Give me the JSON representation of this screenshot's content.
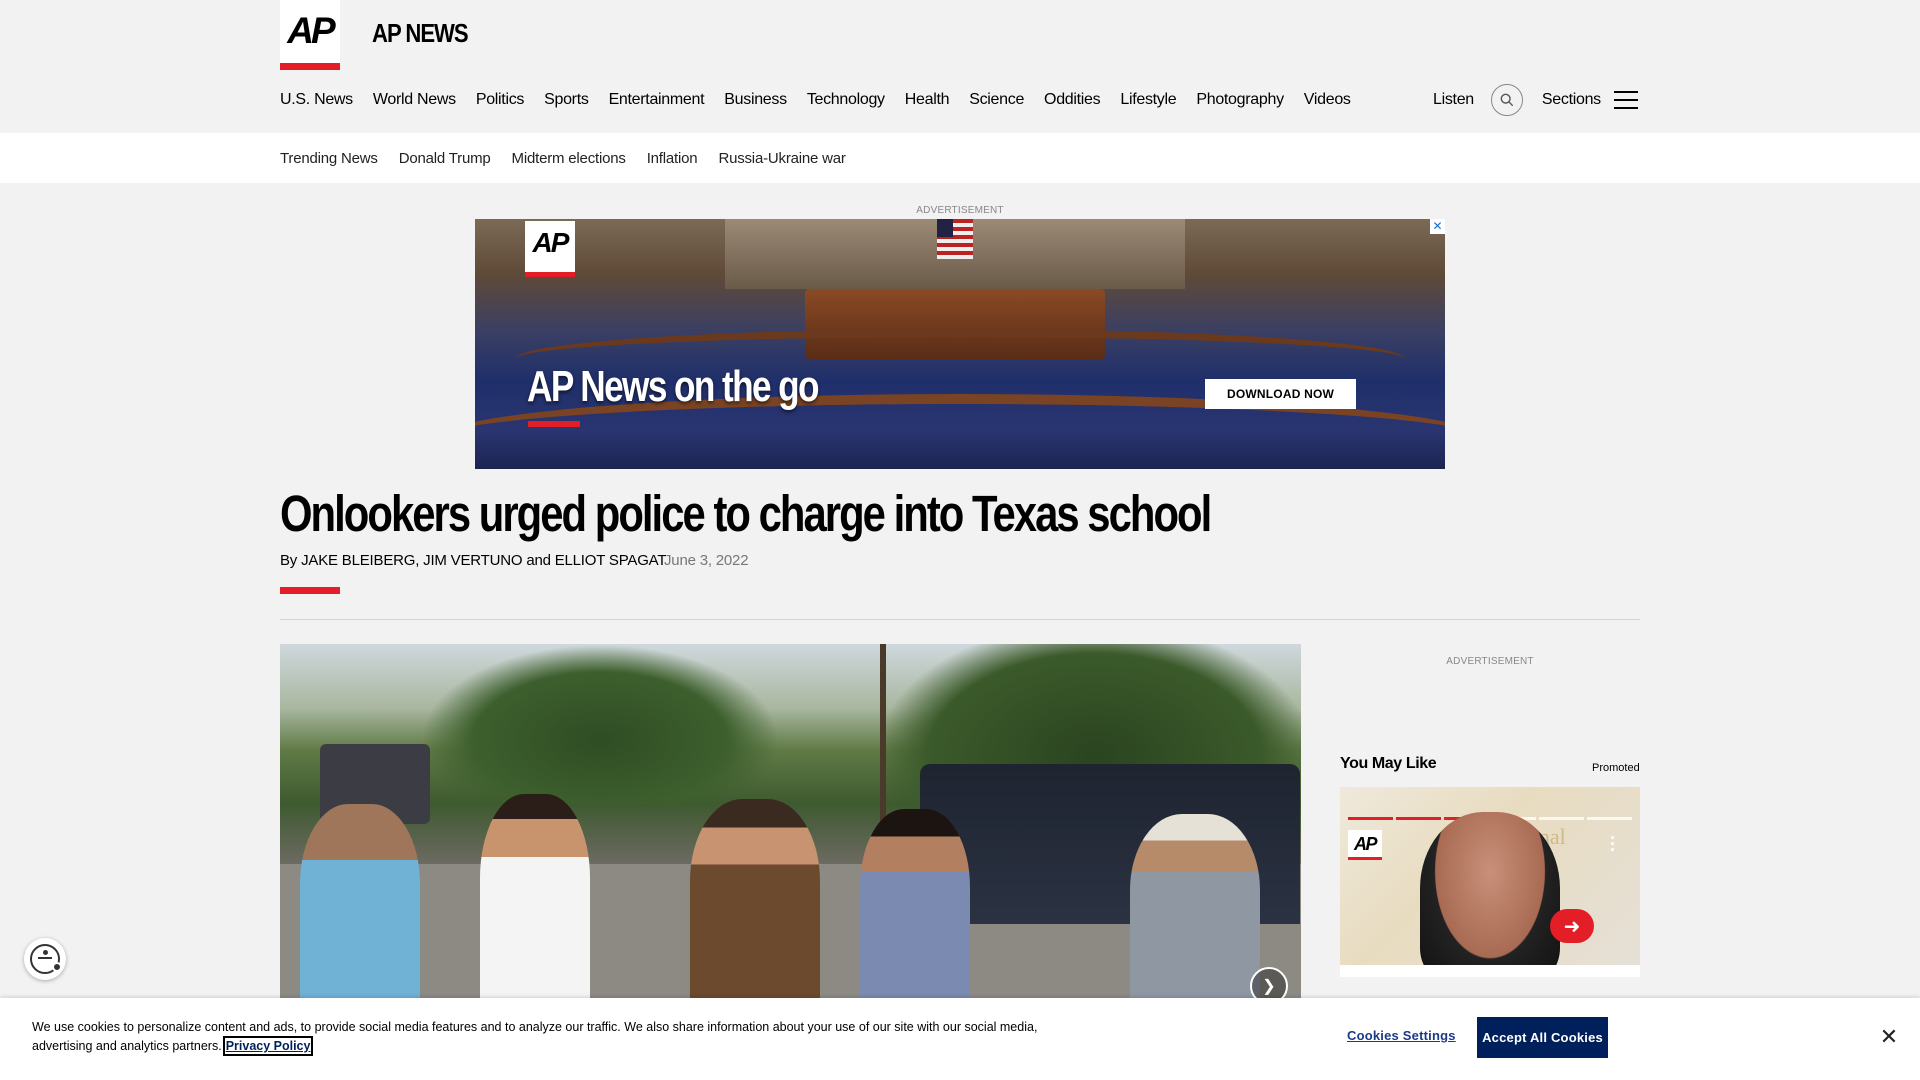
{
  "header": {
    "logo_text": "AP",
    "site_name": "AP NEWS",
    "nav": [
      "U.S. News",
      "World News",
      "Politics",
      "Sports",
      "Entertainment",
      "Business",
      "Technology",
      "Health",
      "Science",
      "Oddities",
      "Lifestyle",
      "Photography",
      "Videos"
    ],
    "listen_label": "Listen",
    "sections_label": "Sections"
  },
  "trending": [
    "Trending News",
    "Donald Trump",
    "Midterm elections",
    "Inflation",
    "Russia-Ukraine war"
  ],
  "ad_top": {
    "label": "ADVERTISEMENT",
    "logo_text": "AP",
    "headline": "AP News on the go",
    "cta": "DOWNLOAD NOW",
    "close": "✕"
  },
  "article": {
    "headline": "Onlookers urged police to charge into Texas school",
    "byline_prefix": "By",
    "authors": "JAKE BLEIBERG, JIM VERTUNO and ELLIOT SPAGAT",
    "date": "June 3, 2022"
  },
  "photo": {
    "next_icon": "chevron-right-icon"
  },
  "sidebar": {
    "ad_label": "ADVERTISEMENT",
    "you_may_like": "You May Like",
    "promoted": "Promoted",
    "promo_logo_text": "AP",
    "promo_bg_text": "National\nBook\nAwards",
    "progress_total": 6,
    "progress_filled": 3
  },
  "cookie": {
    "text": "We use cookies to personalize content and ads, to provide social media features and to analyze our traffic. We also share information about your use of our site with our social media, advertising and analytics partners.",
    "privacy_link": "Privacy Policy",
    "settings_label": "Cookies Settings",
    "accept_label": "Accept All Cookies",
    "close": "✕"
  },
  "colors": {
    "brand_red": "#e41e26",
    "cookie_button": "#00205b"
  }
}
